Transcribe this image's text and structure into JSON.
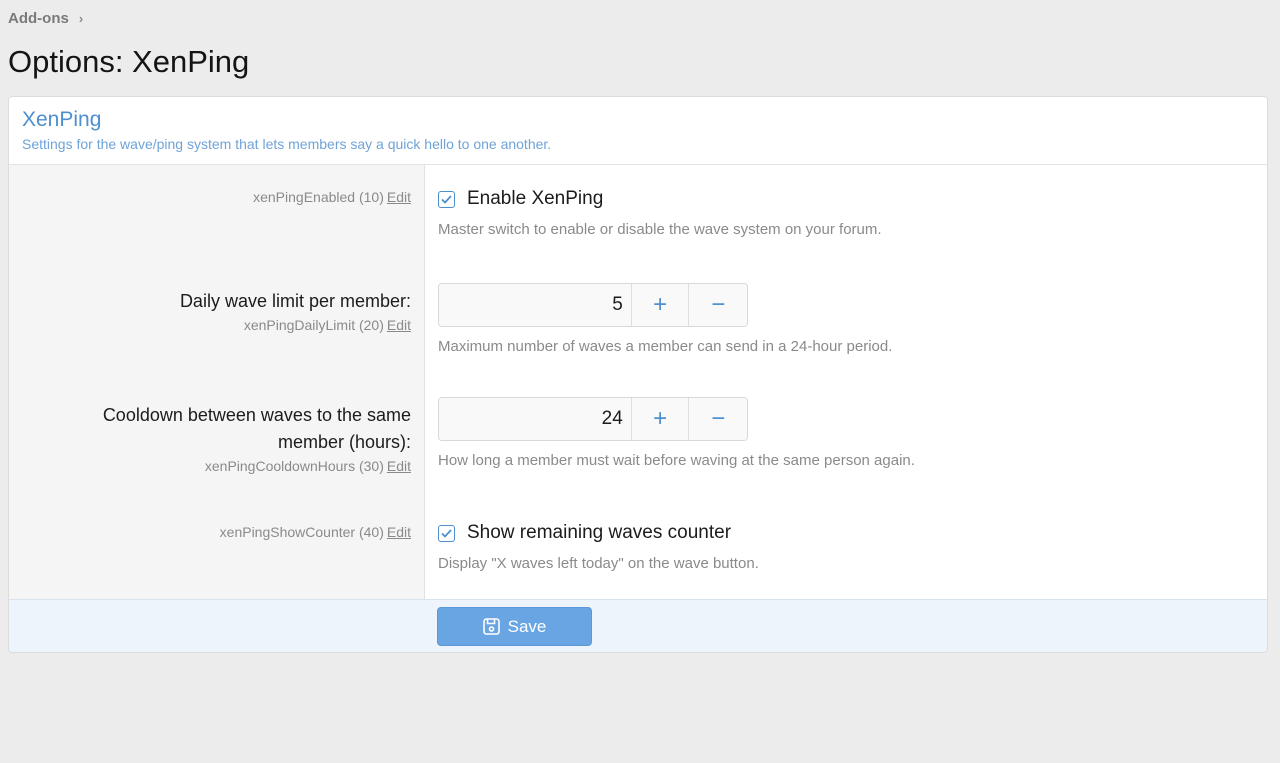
{
  "breadcrumb": {
    "parent": "Add-ons"
  },
  "page": {
    "title": "Options: XenPing"
  },
  "block": {
    "title": "XenPing",
    "description": "Settings for the wave/ping system that lets members say a quick hello to one another."
  },
  "options": [
    {
      "meta": "xenPingEnabled (10)",
      "edit": "Edit",
      "checkbox_label": "Enable XenPing",
      "checked": true,
      "hint": "Master switch to enable or disable the wave system on your forum."
    },
    {
      "label": "Daily wave limit per member:",
      "meta": "xenPingDailyLimit (20)",
      "edit": "Edit",
      "value": "5",
      "hint": "Maximum number of waves a member can send in a 24-hour period."
    },
    {
      "label_line1": "Cooldown between waves to the same",
      "label_line2": "member (hours):",
      "meta": "xenPingCooldownHours (30)",
      "edit": "Edit",
      "value": "24",
      "hint": "How long a member must wait before waving at the same person again."
    },
    {
      "meta": "xenPingShowCounter (40)",
      "edit": "Edit",
      "checkbox_label": "Show remaining waves counter",
      "checked": true,
      "hint": "Display \"X waves left today\" on the wave button."
    }
  ],
  "stepper": {
    "plus": "+",
    "minus": "−"
  },
  "footer": {
    "save_label": "Save"
  },
  "colors": {
    "accent": "#4d8fd0",
    "button": "#69a5e3",
    "footer_bg": "#edf4fb"
  },
  "icons": {
    "breadcrumb_separator": "chevron-right-icon",
    "save": "save-icon",
    "checkbox": "checkmark-icon"
  }
}
